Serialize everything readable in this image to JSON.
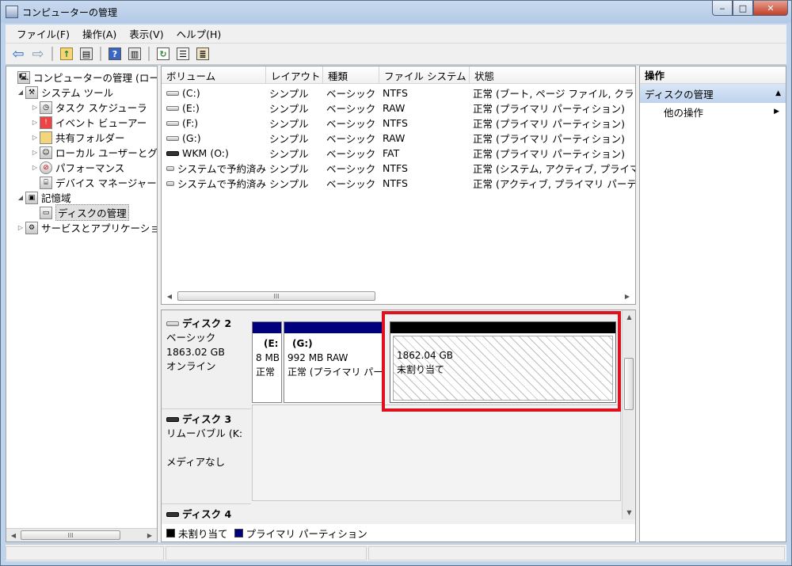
{
  "window": {
    "title": "コンピューターの管理",
    "buttons": {
      "minimize": "‒",
      "maximize": "□",
      "close": "✕"
    }
  },
  "menu": [
    "ファイル(F)",
    "操作(A)",
    "表示(V)",
    "ヘルプ(H)"
  ],
  "toolbar_icons": [
    "back-arrow",
    "forward-arrow",
    "up-folder",
    "show-hide-console-tree",
    "help",
    "show-hide-action-pane",
    "refresh",
    "properties",
    "export"
  ],
  "tree": {
    "root": "コンピューターの管理 (ローカ",
    "system_tools": "システム ツール",
    "task_scheduler": "タスク スケジューラ",
    "event_viewer": "イベント ビューアー",
    "shared_folders": "共有フォルダー",
    "local_users": "ローカル ユーザーとグ",
    "performance": "パフォーマンス",
    "device_manager": "デバイス マネージャー",
    "storage": "記憶域",
    "disk_management": "ディスクの管理",
    "services_apps": "サービスとアプリケーショ"
  },
  "volume_list": {
    "columns": [
      "ボリューム",
      "レイアウト",
      "種類",
      "ファイル システム",
      "状態"
    ],
    "rows": [
      {
        "volume": "(C:)",
        "layout": "シンプル",
        "type": "ベーシック",
        "fs": "NTFS",
        "status": "正常 (ブート, ページ ファイル, クラ"
      },
      {
        "volume": "(E:)",
        "layout": "シンプル",
        "type": "ベーシック",
        "fs": "RAW",
        "status": "正常 (プライマリ パーティション)"
      },
      {
        "volume": "(F:)",
        "layout": "シンプル",
        "type": "ベーシック",
        "fs": "NTFS",
        "status": "正常 (プライマリ パーティション)"
      },
      {
        "volume": "(G:)",
        "layout": "シンプル",
        "type": "ベーシック",
        "fs": "RAW",
        "status": "正常 (プライマリ パーティション)"
      },
      {
        "volume": "WKM (O:)",
        "layout": "シンプル",
        "type": "ベーシック",
        "fs": "FAT",
        "status": "正常 (プライマリ パーティション)"
      },
      {
        "volume": "システムで予約済み",
        "layout": "シンプル",
        "type": "ベーシック",
        "fs": "NTFS",
        "status": "正常 (システム, アクティブ, プライマ"
      },
      {
        "volume": "システムで予約済み",
        "layout": "シンプル",
        "type": "ベーシック",
        "fs": "NTFS",
        "status": "正常 (アクティブ, プライマリ パーテ"
      }
    ]
  },
  "disks": {
    "disk2": {
      "name": "ディスク 2",
      "type": "ベーシック",
      "size": "1863.02 GB",
      "state": "オンライン",
      "partitions": [
        {
          "title": "(E:",
          "line1": "8 MB",
          "line2": "正常"
        },
        {
          "title": "(G:)",
          "line1": "992 MB RAW",
          "line2": "正常 (プライマリ パー"
        },
        {
          "title": "",
          "line1": "1862.04 GB",
          "line2": "未割り当て"
        }
      ]
    },
    "disk3": {
      "name": "ディスク 3",
      "type": "リムーバブル (K:",
      "state": "メディアなし"
    },
    "disk4": {
      "name": "ディスク 4"
    }
  },
  "legend": [
    {
      "label": "未割り当て",
      "color": "#000000"
    },
    {
      "label": "プライマリ パーティション",
      "color": "#00007f"
    }
  ],
  "actions": {
    "header": "操作",
    "section": "ディスクの管理",
    "other": "他の操作"
  },
  "scroll_glyphs": {
    "left": "◀",
    "right": "▶",
    "up": "▲",
    "down": "▼",
    "grip": "III"
  },
  "colors": {
    "highlight": "#e0101e",
    "primary_partition": "#00007f",
    "unallocated": "#000000"
  }
}
